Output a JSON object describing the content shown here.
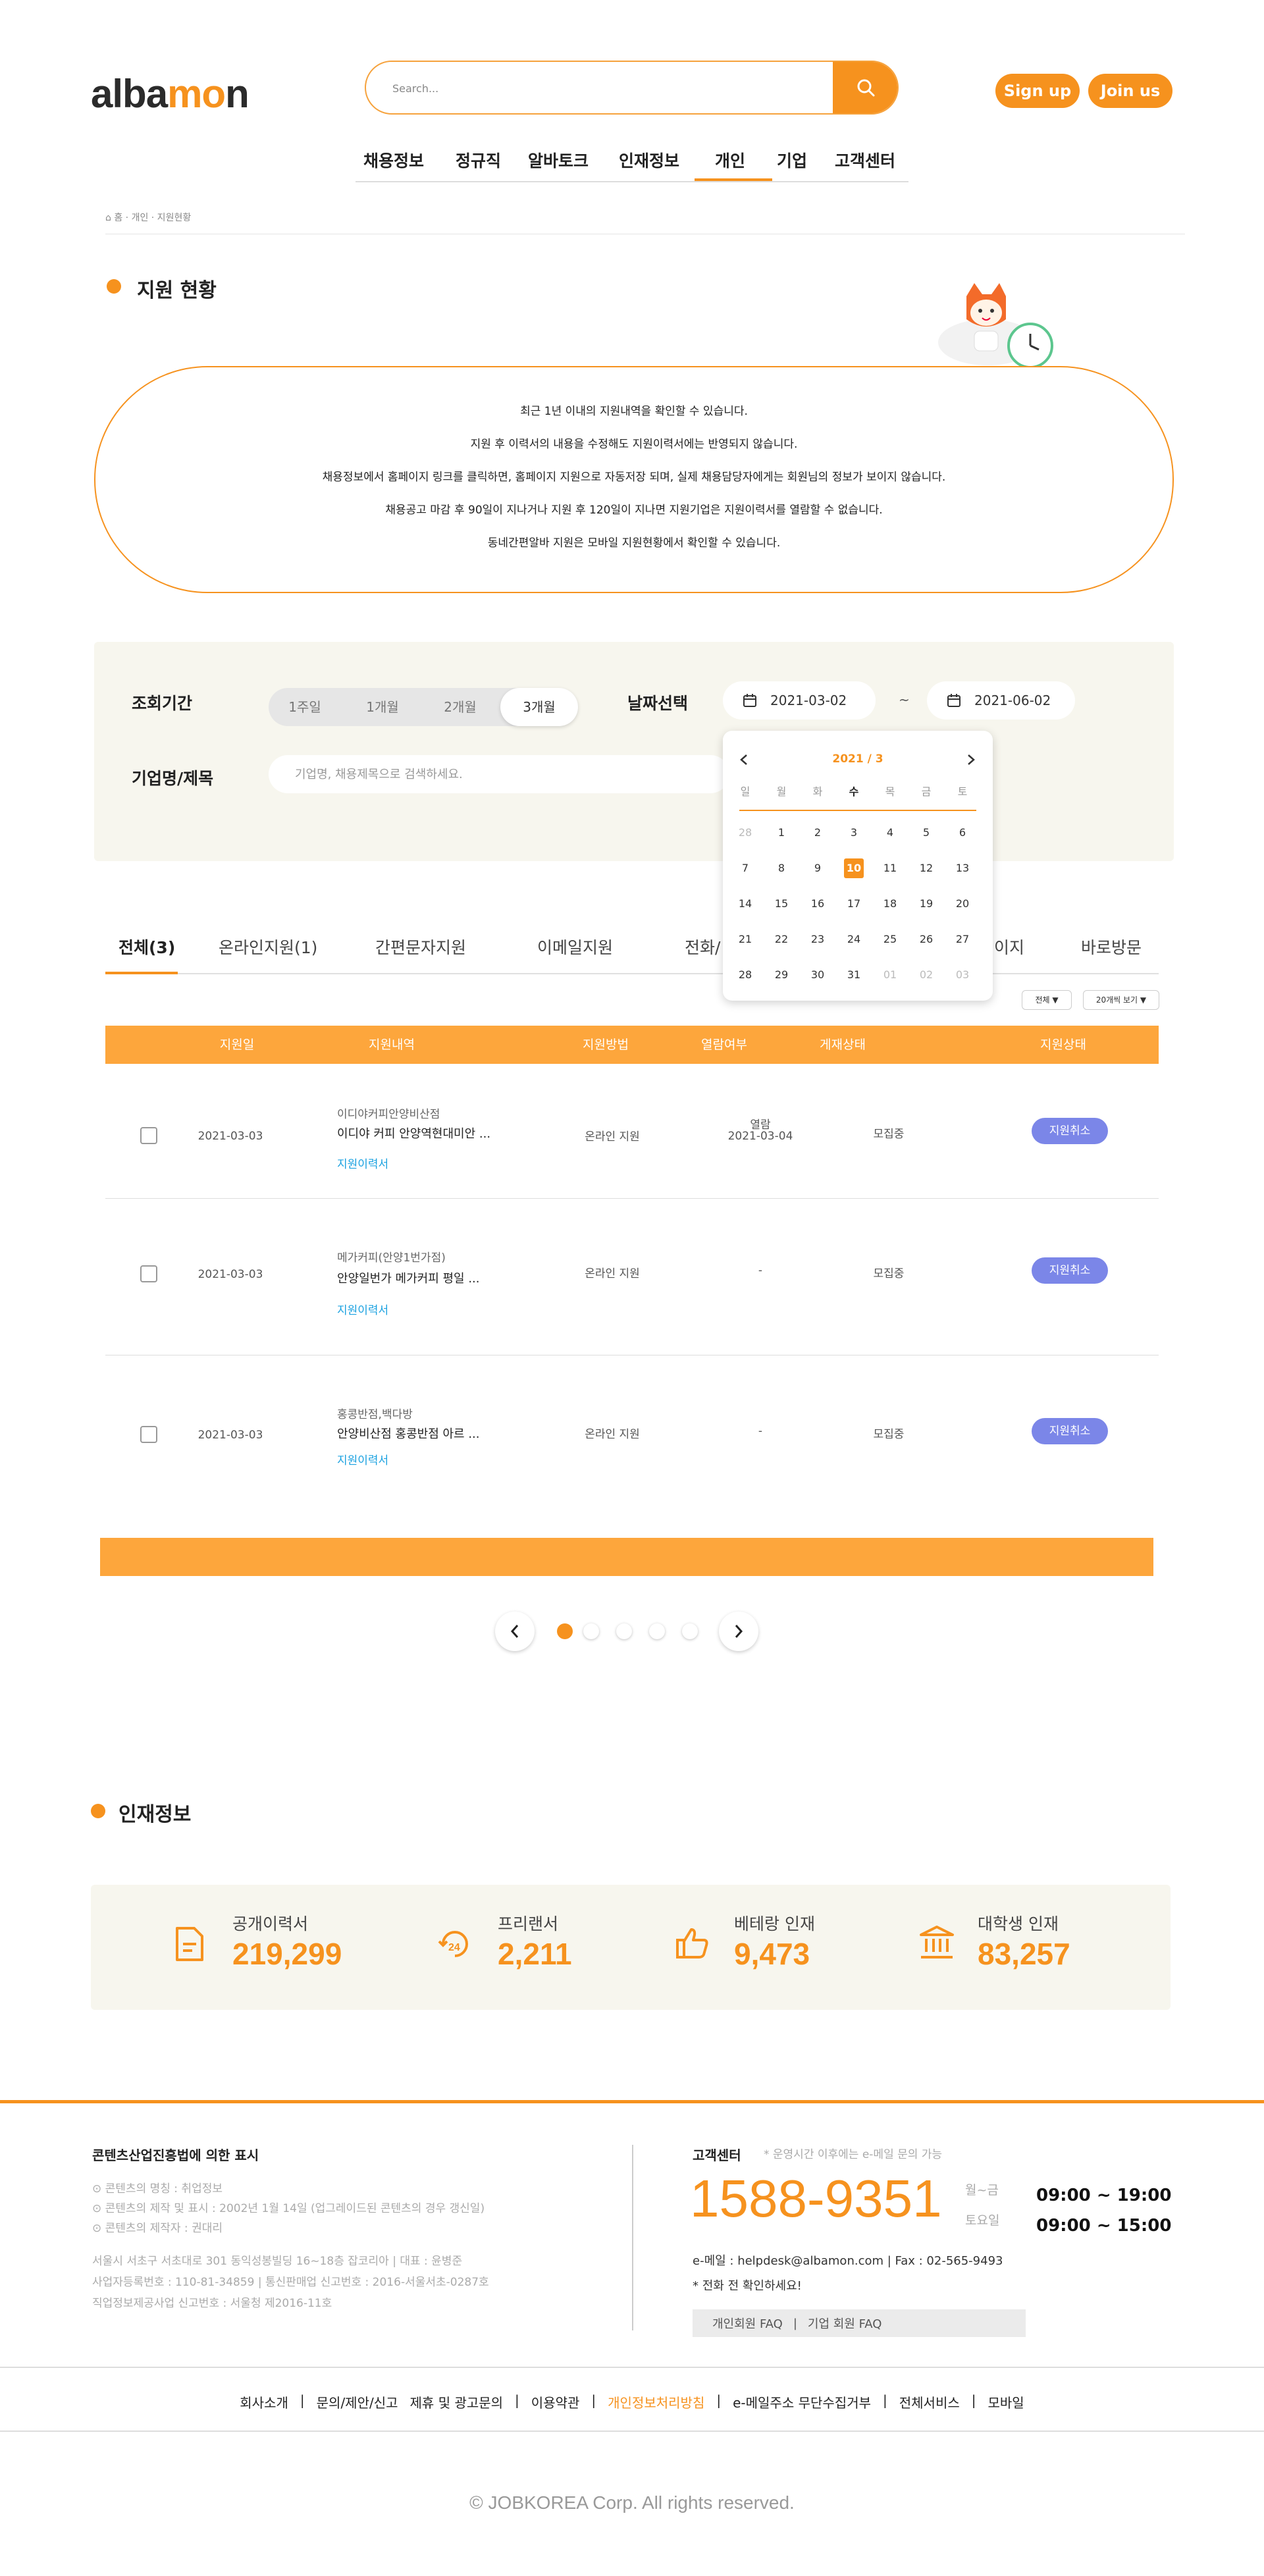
{
  "header": {
    "logo_pre": "alba",
    "logo_o": "m",
    "logo_post": "n",
    "search_placeholder": "Search...",
    "signup": "Sign up",
    "joinus": "Join us"
  },
  "nav": [
    "채용정보",
    "정규직",
    "알바토크",
    "인재정보",
    "개인",
    "기업",
    "고객센터"
  ],
  "breadcrumb": "홈 · 개인 · 지원현황",
  "page_title": "지원 현황",
  "notices": [
    "최근 1년 이내의 지원내역을 확인할 수 있습니다.",
    "지원 후 이력서의 내용을 수정해도 지원이력서에는 반영되지 않습니다.",
    "채용정보에서 홈페이지 링크를 클릭하면, 홈페이지 지원으로 자동저장 되며, 실제 채용담당자에게는 회원님의 정보가 보이지 않습니다.",
    "채용공고 마감 후 90일이 지나거나 지원 후 120일이 지나면 지원기업은 지원이력서를 열람할 수 없습니다.",
    "동네간편알바 지원은 모바일 지원현황에서 확인할 수 있습니다."
  ],
  "filter": {
    "period_label": "조회기간",
    "periods": [
      "1주일",
      "1개월",
      "2개월",
      "3개월"
    ],
    "date_label": "날짜선택",
    "date_from": "2021-03-02",
    "tilde": "~",
    "date_to": "2021-06-02",
    "company_label": "기업명/제목",
    "keyword_placeholder": "기업명, 채용제목으로 검색하세요."
  },
  "calendar": {
    "title": "2021 / 3",
    "weekdays": [
      "일",
      "월",
      "화",
      "수",
      "목",
      "금",
      "토"
    ],
    "weeks": [
      [
        "28",
        "1",
        "2",
        "3",
        "4",
        "5",
        "6"
      ],
      [
        "7",
        "8",
        "9",
        "10",
        "11",
        "12",
        "13"
      ],
      [
        "14",
        "15",
        "16",
        "17",
        "18",
        "19",
        "20"
      ],
      [
        "21",
        "22",
        "23",
        "24",
        "25",
        "26",
        "27"
      ],
      [
        "28",
        "29",
        "30",
        "31",
        "01",
        "02",
        "03"
      ]
    ],
    "selected": "10"
  },
  "tabs": [
    "전체(3)",
    "온라인지원(1)",
    "간편문자지원",
    "이메일지원",
    "전화/",
    "이지",
    "바로방문"
  ],
  "selects": [
    "전체 ▼",
    "20개씩 보기 ▼"
  ],
  "table": {
    "headers": [
      "지원일",
      "지원내역",
      "지원방법",
      "열람여부",
      "게재상태",
      "지원상태"
    ],
    "rows": [
      {
        "date": "2021-03-03",
        "company": "이디야커피안양비산점",
        "title": "이디야 커피 안양역현대미안 ...",
        "link": "지원이력서",
        "method": "온라인 지원",
        "read": "열람",
        "read_date": "2021-03-04",
        "status": "모집중",
        "action": "지원취소"
      },
      {
        "date": "2021-03-03",
        "company": "메가커피(안양1번가점)",
        "title": "안양일번가 메가커피 평일 ...",
        "link": "지원이력서",
        "method": "온라인 지원",
        "read": "-",
        "read_date": "",
        "status": "모집중",
        "action": "지원취소"
      },
      {
        "date": "2021-03-03",
        "company": "홍콩반점,백다방",
        "title": "안양비산점 홍콩반점 아르 ...",
        "link": "지원이력서",
        "method": "온라인 지원",
        "read": "-",
        "read_date": "",
        "status": "모집중",
        "action": "지원취소"
      }
    ]
  },
  "talent": {
    "title": "인재정보",
    "stats": [
      {
        "label": "공개이력서",
        "value": "219,299",
        "icon": "document-icon"
      },
      {
        "label": "프리랜서",
        "value": "2,211",
        "icon": "clock-24-icon"
      },
      {
        "label": "베테랑 인재",
        "value": "9,473",
        "icon": "thumbs-up-icon"
      },
      {
        "label": "대학생 인재",
        "value": "83,257",
        "icon": "university-icon"
      }
    ]
  },
  "footer": {
    "law_title": "콘텐츠산업진흥법에 의한 표시",
    "law_lines": [
      "⊙ 콘텐츠의 명칭 : 취업정보",
      "⊙ 콘텐츠의 제작 및 표시 : 2002년 1월 14일 (업그레이드된 콘텐츠의 경우 갱신일)",
      "⊙ 콘텐츠의 제작자 : 권대리"
    ],
    "addr_lines": [
      "서울시 서초구 서초대로 301 동익성봉빌딩 16~18층 잡코리아 | 대표 : 윤병준",
      "사업자등록번호 : 110-81-34859 | 통신판매업 신고번호 : 2016-서울서초-0287호",
      "직업정보제공사업 신고번호 : 서울청 제2016-11호"
    ],
    "cs_title": "고객센터",
    "cs_note": "* 운영시간 이후에는 e-메일 문의 가능",
    "phone": "1588-9351",
    "days": [
      "월~금",
      "토요일"
    ],
    "hours": [
      "09:00 ~ 19:00",
      "09:00 ~ 15:00"
    ],
    "email": "e-메일 : helpdesk@albamon.com | Fax : 02-565-9493",
    "call_note": "* 전화 전 확인하세요!",
    "faq": [
      "개인회원 FAQ",
      "기업 회원 FAQ"
    ],
    "links": [
      "회사소개",
      "문의/제안/신고",
      "제휴 및 광고문의",
      "이용약관",
      "개인정보처리방침",
      "e-메일주소 무단수집거부",
      "전체서비스",
      "모바일"
    ],
    "copyright": "© JOBKOREA Corp. All rights reserved."
  },
  "colors": {
    "accent": "#f6921e",
    "table_header": "#fda63c",
    "cancel": "#7b86e8",
    "link": "#1aa1e0"
  }
}
